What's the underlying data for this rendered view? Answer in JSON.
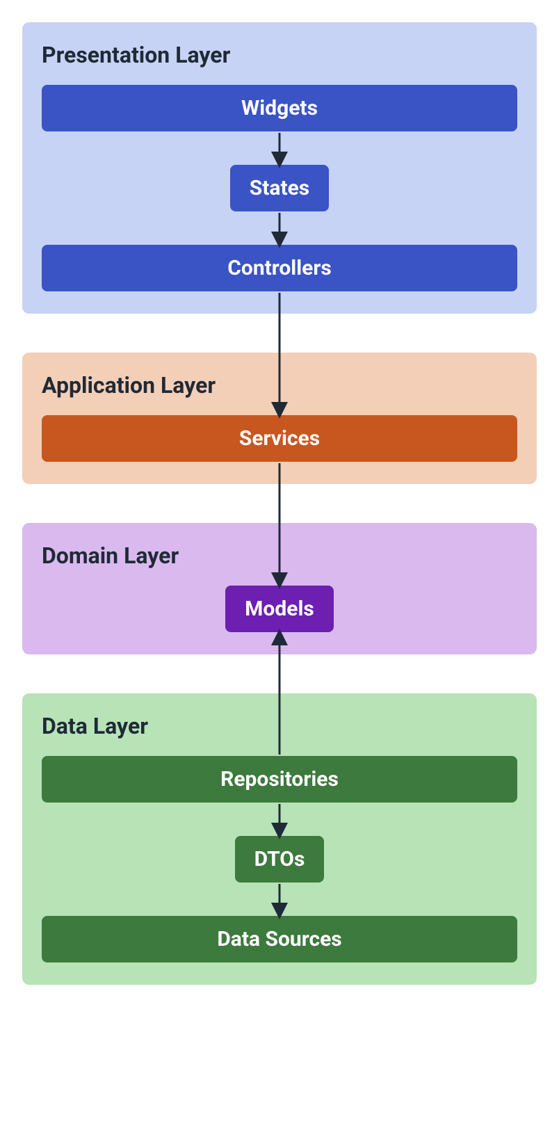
{
  "layers": {
    "presentation": {
      "title": "Presentation Layer",
      "nodes": {
        "widgets": "Widgets",
        "states": "States",
        "controllers": "Controllers"
      }
    },
    "application": {
      "title": "Application Layer",
      "nodes": {
        "services": "Services"
      }
    },
    "domain": {
      "title": "Domain Layer",
      "nodes": {
        "models": "Models"
      }
    },
    "data": {
      "title": "Data Layer",
      "nodes": {
        "repositories": "Repositories",
        "dtos": "DTOs",
        "data_sources": "Data Sources"
      }
    }
  },
  "colors": {
    "presentation_bg": "#c6d3f4",
    "presentation_node": "#3a53c5",
    "application_bg": "#f3cfb8",
    "application_node": "#c7571f",
    "domain_bg": "#d9b9ee",
    "domain_node": "#6c1fb0",
    "data_bg": "#b7e3b7",
    "data_node": "#3d7a3d",
    "arrow": "#1f2a37"
  },
  "arrows": [
    {
      "from": "widgets",
      "to": "states",
      "direction": "down"
    },
    {
      "from": "states",
      "to": "controllers",
      "direction": "down"
    },
    {
      "from": "controllers",
      "to": "services",
      "direction": "down"
    },
    {
      "from": "services",
      "to": "models",
      "direction": "down"
    },
    {
      "from": "repositories",
      "to": "models",
      "direction": "up"
    },
    {
      "from": "repositories",
      "to": "dtos",
      "direction": "down"
    },
    {
      "from": "dtos",
      "to": "data_sources",
      "direction": "down"
    }
  ]
}
